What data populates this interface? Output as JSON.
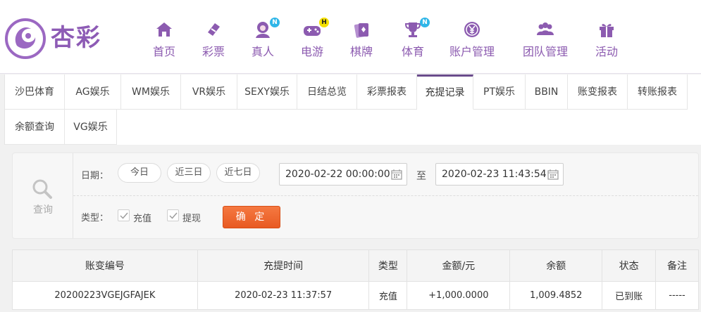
{
  "header": {
    "logo_text": "杏彩",
    "nav": [
      {
        "label": "首页",
        "icon": "home-icon"
      },
      {
        "label": "彩票",
        "icon": "lottery-ticket-icon"
      },
      {
        "label": "真人",
        "icon": "live-dealer-icon",
        "badge": "N"
      },
      {
        "label": "电游",
        "icon": "gamepad-icon",
        "badge": "H"
      },
      {
        "label": "棋牌",
        "icon": "cards-icon"
      },
      {
        "label": "体育",
        "icon": "trophy-icon",
        "badge": "N"
      },
      {
        "label": "账户管理",
        "icon": "yen-coin-icon"
      },
      {
        "label": "团队管理",
        "icon": "team-icon"
      },
      {
        "label": "活动",
        "icon": "gift-icon"
      }
    ]
  },
  "tabs": [
    {
      "label": "沙巴体育"
    },
    {
      "label": "AG娱乐"
    },
    {
      "label": "WM娱乐"
    },
    {
      "label": "VR娱乐"
    },
    {
      "label": "SEXY娱乐"
    },
    {
      "label": "日结总览"
    },
    {
      "label": "彩票报表"
    },
    {
      "label": "充提记录",
      "active": true
    },
    {
      "label": "PT娱乐"
    },
    {
      "label": "BBIN"
    },
    {
      "label": "账变报表"
    },
    {
      "label": "转账报表"
    },
    {
      "label": "余额查询"
    },
    {
      "label": "VG娱乐"
    }
  ],
  "search": {
    "label": "查询",
    "date_label": "日期：",
    "quick": [
      "今日",
      "近三日",
      "近七日"
    ],
    "start": "2020-02-22 00:00:00",
    "separator": "至",
    "end": "2020-02-23 11:43:54",
    "type_label": "类型：",
    "types": [
      {
        "label": "充值",
        "checked": true
      },
      {
        "label": "提现",
        "checked": true
      }
    ],
    "confirm": "确 定"
  },
  "table": {
    "headers": [
      "账变编号",
      "充提时间",
      "类型",
      "金额/元",
      "余额",
      "状态",
      "备注"
    ],
    "rows": [
      [
        "20200223VGEJGFAJEK",
        "2020-02-23 11:37:57",
        "充值",
        "+1,000.0000",
        "1,009.4852",
        "已到账",
        "-----"
      ]
    ]
  },
  "colors": {
    "brand": "#8c5bb0",
    "accent": "#e85a22",
    "amount": "#e02020",
    "success": "#2e9b2e"
  }
}
